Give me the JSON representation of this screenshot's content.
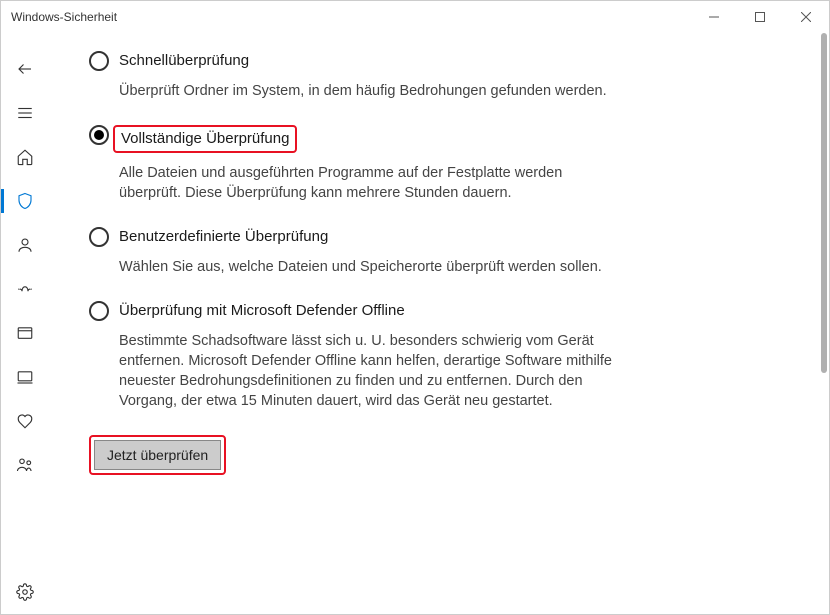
{
  "window": {
    "title": "Windows-Sicherheit"
  },
  "options": {
    "quick": {
      "title": "Schnellüberprüfung",
      "desc": "Überprüft Ordner im System, in dem häufig Bedrohungen gefunden werden."
    },
    "full": {
      "title": "Vollständige Überprüfung",
      "desc": "Alle Dateien und ausgeführten Programme auf der Festplatte werden überprüft. Diese Überprüfung kann mehrere Stunden dauern."
    },
    "custom": {
      "title": "Benutzerdefinierte Überprüfung",
      "desc": "Wählen Sie aus, welche Dateien und Speicherorte überprüft werden sollen."
    },
    "offline": {
      "title": "Überprüfung mit Microsoft Defender Offline",
      "desc": "Bestimmte Schadsoftware lässt sich u. U. besonders schwierig vom Gerät entfernen. Microsoft Defender Offline kann helfen, derartige Software mithilfe neuester Bedrohungsdefinitionen zu finden und zu entfernen. Durch den Vorgang, der etwa 15 Minuten dauert, wird das Gerät neu gestartet."
    }
  },
  "button": {
    "scan_now": "Jetzt überprüfen"
  }
}
